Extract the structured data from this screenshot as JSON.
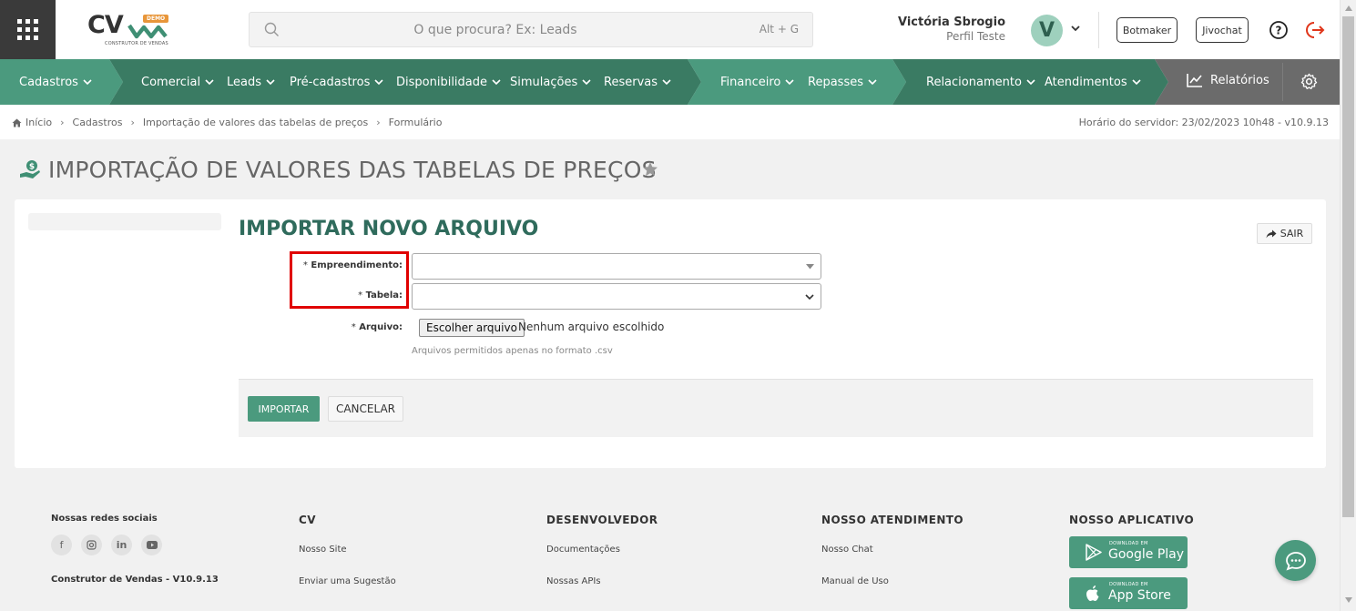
{
  "header": {
    "logo_demo_badge": "DEMO",
    "logo_text": "CV",
    "logo_tagline": "CONSTRUTOR DE VENDAS",
    "search_placeholder": "O que procura? Ex: Leads",
    "search_shortcut": "Alt + G",
    "user_name": "Victória Sbrogio",
    "user_profile": "Perfil Teste",
    "avatar_initial": "V",
    "botmaker_label": "Botmaker",
    "jivochat_label": "Jivochat"
  },
  "nav": {
    "items": [
      {
        "label": "Cadastros"
      },
      {
        "label": "Comercial"
      },
      {
        "label": "Leads"
      },
      {
        "label": "Pré-cadastros"
      },
      {
        "label": "Disponibilidade"
      },
      {
        "label": "Simulações"
      },
      {
        "label": "Reservas"
      },
      {
        "label": "Financeiro"
      },
      {
        "label": "Repasses"
      },
      {
        "label": "Relacionamento"
      },
      {
        "label": "Atendimentos"
      }
    ],
    "reports_label": "Relatórios",
    "colors": {
      "light": "#4b9a7e",
      "dark": "#3a7b63",
      "gray": "#6b6b6b"
    }
  },
  "breadcrumb": {
    "items": [
      "Início",
      "Cadastros",
      "Importação de valores das tabelas de preços",
      "Formulário"
    ],
    "server_time": "Horário do servidor: 23/02/2023 10h48 - v10.9.13"
  },
  "page": {
    "title": "IMPORTAÇÃO DE VALORES DAS TABELAS DE PREÇOS"
  },
  "form": {
    "title": "IMPORTAR NOVO ARQUIVO",
    "exit_label": "SAIR",
    "fields": {
      "empreendimento_label": "Empreendimento:",
      "tabela_label": "Tabela:",
      "arquivo_label": "Arquivo:",
      "required_mark": "*",
      "empreendimento_value": "",
      "tabela_value": ""
    },
    "file_button": "Escolher arquivo",
    "file_status": "Nenhum arquivo escolhido",
    "file_hint": "Arquivos permitidos apenas no formato .csv",
    "import_label": "IMPORTAR",
    "cancel_label": "CANCELAR"
  },
  "footer": {
    "social_title": "Nossas redes sociais",
    "social_icons": [
      "facebook-icon",
      "instagram-icon",
      "linkedin-icon",
      "youtube-icon"
    ],
    "version": "Construtor de Vendas - V10.9.13",
    "columns": [
      {
        "title": "CV",
        "links": [
          "Nosso Site",
          "Enviar uma Sugestão"
        ]
      },
      {
        "title": "DESENVOLVEDOR",
        "links": [
          "Documentações",
          "Nossas APIs"
        ]
      },
      {
        "title": "NOSSO ATENDIMENTO",
        "links": [
          "Nosso Chat",
          "Manual de Uso"
        ]
      }
    ],
    "app_title": "NOSSO APLICATIVO",
    "google_small": "DOWNLOAD EM",
    "google_big": "Google Play",
    "apple_small": "DOWNLOAD EM",
    "apple_big": "App Store"
  }
}
